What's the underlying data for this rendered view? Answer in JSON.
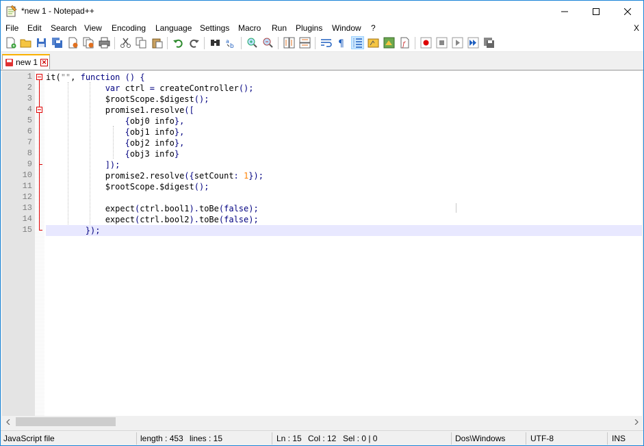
{
  "window": {
    "title": "*new 1 - Notepad++",
    "minimize_icon": "minimize-icon",
    "maximize_icon": "maximize-icon",
    "close_icon": "close-icon"
  },
  "menu": {
    "items": [
      "File",
      "Edit",
      "Search",
      "View",
      "Encoding",
      "Language",
      "Settings",
      "Macro",
      "Run",
      "Plugins",
      "Window",
      "?"
    ],
    "close_doc": "X"
  },
  "toolbar": {
    "icons": [
      "new-file-icon",
      "open-file-icon",
      "save-icon",
      "save-all-icon",
      "close-icon",
      "close-all-icon",
      "print-icon",
      "cut-icon",
      "copy-icon",
      "paste-icon",
      "undo-icon",
      "redo-icon",
      "find-icon",
      "replace-icon",
      "zoom-in-icon",
      "zoom-out-icon",
      "sync-vertical-icon",
      "sync-horizontal-icon",
      "word-wrap-icon",
      "show-all-chars-icon",
      "indent-guide-icon",
      "udl-icon",
      "doc-map-icon",
      "function-list-icon",
      "record-macro-icon",
      "stop-macro-icon",
      "play-macro-icon",
      "run-macro-multiple-icon",
      "save-macro-icon"
    ],
    "pressed_icon": "indent-guide-icon"
  },
  "tab": {
    "label": "new 1",
    "close_glyph": "✕"
  },
  "editor": {
    "line_numbers": [
      "1",
      "2",
      "3",
      "4",
      "5",
      "6",
      "7",
      "8",
      "9",
      "10",
      "11",
      "12",
      "13",
      "14",
      "15"
    ],
    "current_line": 15
  },
  "status": {
    "file_type": "JavaScript file",
    "length": "length : 453",
    "lines": "lines : 15",
    "ln": "Ln : 15",
    "col": "Col : 12",
    "sel": "Sel : 0 | 0",
    "eol": "Dos\\Windows",
    "encoding": "UTF-8",
    "mode": "INS"
  }
}
